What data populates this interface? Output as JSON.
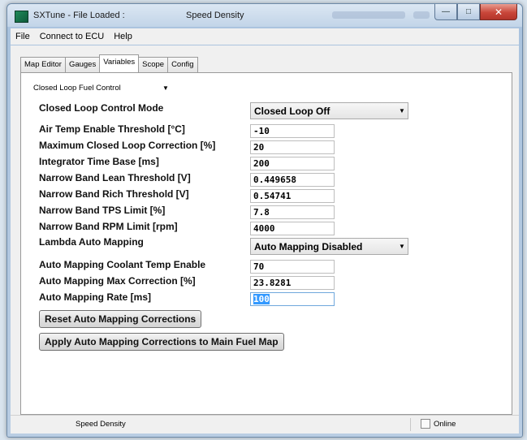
{
  "window": {
    "title": "SXTune - File Loaded :",
    "title_mode": "Speed Density",
    "controls": {
      "minimize": "—",
      "maximize": "□",
      "close": "✕"
    }
  },
  "menu": [
    "File",
    "Connect to ECU",
    "Help"
  ],
  "tabs": [
    "Map Editor",
    "Gauges",
    "Variables",
    "Scope",
    "Config"
  ],
  "active_tab": "Variables",
  "category": {
    "value": "Closed Loop Fuel Control"
  },
  "settings": {
    "closed_loop_mode": {
      "label": "Closed Loop Control Mode",
      "value": "Closed Loop Off"
    },
    "air_temp": {
      "label": "Air Temp Enable Threshold [°C]",
      "value": "-10"
    },
    "max_correction": {
      "label": "Maximum Closed Loop Correction [%]",
      "value": "20"
    },
    "integrator": {
      "label": "Integrator Time Base [ms]",
      "value": "200"
    },
    "lean_threshold": {
      "label": "Narrow Band Lean Threshold [V]",
      "value": "0.449658"
    },
    "rich_threshold": {
      "label": "Narrow Band Rich Threshold [V]",
      "value": "0.54741"
    },
    "tps_limit": {
      "label": "Narrow Band TPS Limit [%]",
      "value": "7.8"
    },
    "rpm_limit": {
      "label": "Narrow Band RPM Limit [rpm]",
      "value": "4000"
    },
    "lambda_mapping": {
      "label": "Lambda Auto Mapping",
      "value": "Auto Mapping Disabled"
    },
    "coolant_enable": {
      "label": "Auto Mapping Coolant Temp Enable",
      "value": "70"
    },
    "mapping_max_corr": {
      "label": "Auto Mapping Max Correction [%]",
      "value": "23.8281"
    },
    "mapping_rate": {
      "label": "Auto Mapping Rate [ms]",
      "value": "100"
    }
  },
  "buttons": {
    "reset": "Reset Auto Mapping Corrections",
    "apply": "Apply Auto Mapping Corrections to Main Fuel Map"
  },
  "status": {
    "mode": "Speed Density",
    "online_label": "Online",
    "online_checked": false
  }
}
